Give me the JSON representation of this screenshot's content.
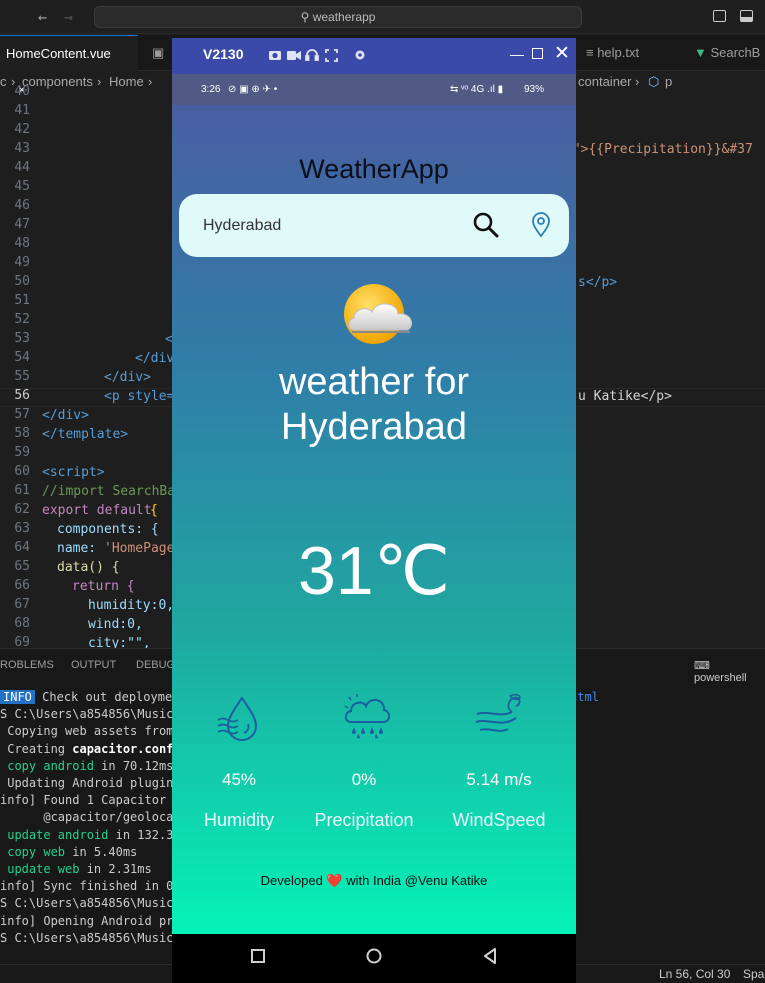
{
  "titlebar": {
    "search": "weatherapp",
    "back_icon": "arrow-left-icon",
    "forward_icon": "arrow-right-icon"
  },
  "tabs": [
    {
      "label": "HomeContent.vue"
    },
    {
      "label": "help.txt"
    },
    {
      "label": "SearchB"
    }
  ],
  "breadcrumb": {
    "a": "c",
    "b": "components",
    "c": "Home",
    "d": "container",
    "e": "p"
  },
  "code": {
    "line_numbers": [
      "40",
      "41",
      "42",
      "43",
      "44",
      "45",
      "46",
      "47",
      "48",
      "49",
      "50",
      "51",
      "52",
      "53",
      "54",
      "55",
      "56",
      "57",
      "58",
      "59",
      "60",
      "61",
      "62",
      "63",
      "64",
      "65",
      "66",
      "67",
      "68",
      "69"
    ],
    "precip_fragment": "y\">{{Precipitation}}&#37",
    "s_p": "s</p>",
    "l53": "<",
    "l54": "</div",
    "l55": "</div>",
    "l56a": "<p style=",
    "l56b": "u Katike</p>",
    "l57": "</div>",
    "l58": "</template>",
    "l60": "<script>",
    "l61": "//import SearchBa",
    "l62a": "export default",
    "l62b": "{",
    "l63": "components: {",
    "l64a": "name: ",
    "l64b": "'HomePage",
    "l65": "data() {",
    "l66": "return {",
    "l67": "humidity:0,",
    "l68": "wind:0,",
    "l69": "city:\"\","
  },
  "panel": {
    "tabs": [
      "ROBLEMS",
      "OUTPUT",
      "DEBUG"
    ],
    "shell": "powershell",
    "lines": [
      {
        "badge": "INFO",
        "text": "Check out deploymen",
        "tail": "ntml"
      },
      {
        "text": "S C:\\Users\\a854856\\Music\\"
      },
      {
        "text": " Copying web assets from"
      },
      {
        "pre": " Creating ",
        "bold": "capacitor.confi"
      },
      {
        "green": " copy android",
        "rest": " in 70.12ms"
      },
      {
        "text": " Updating Android plugins"
      },
      {
        "text": "info] Found 1 Capacitor p"
      },
      {
        "text": "      @capacitor/geolocat"
      },
      {
        "green": " update android",
        "rest": " in 132.38"
      },
      {
        "green": " copy web",
        "rest": " in 5.40ms"
      },
      {
        "green": " update web",
        "rest": " in 2.31ms"
      },
      {
        "text": "info] Sync finished in 0."
      },
      {
        "text": "S C:\\Users\\a854856\\Music\\"
      },
      {
        "text": "info] Opening Android pro"
      },
      {
        "text": "S C:\\Users\\a854856\\Music\\"
      }
    ]
  },
  "statusbar": {
    "position": "Ln 56, Col 30",
    "spaces": "Spac"
  },
  "emulator": {
    "name": "V2130",
    "system": {
      "time": "3:26",
      "status_left": "⊘ ▣ ⊕ ✈ •",
      "status_right": "⇆ ᵛᵒ 4G .ıl ▮",
      "battery": "93%"
    },
    "app": {
      "title": "WeatherApp",
      "search_value": "Hyderabad",
      "heading": "weather for Hyderabad",
      "temperature": "31℃",
      "stats": [
        {
          "value": "45%",
          "label": "Humidity",
          "icon": "humidity-icon"
        },
        {
          "value": "0%",
          "label": "Precipitation",
          "icon": "rain-cloud-icon"
        },
        {
          "value": "5.14 m/s",
          "label": "WindSpeed",
          "icon": "wind-icon"
        }
      ],
      "footer": {
        "pre": "Developed",
        "heart": "❤️",
        "post": "with India @Venu Katike"
      }
    }
  },
  "colors": {
    "accent": "#0078d4",
    "emulator_frame": "#3f51b5",
    "gradient_bottom": "#05f3b8"
  }
}
